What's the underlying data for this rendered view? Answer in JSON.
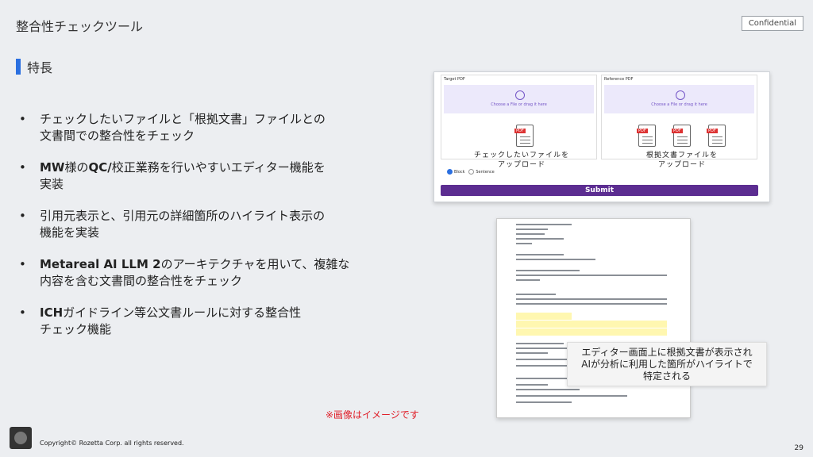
{
  "header": {
    "title": "整合性チェックツール",
    "badge": "Confidential"
  },
  "section": {
    "title": "特長"
  },
  "bullets": [
    [
      "",
      "チェックしたいファイルと「根拠文書」ファイルとの",
      ""
    ],
    [
      "",
      "文書間での整合性をチェック",
      ""
    ]
  ],
  "features": {
    "b1_line1": "チェックしたいファイルと「根拠文書」ファイルとの",
    "b1_line2": "文書間での整合性をチェック",
    "b2_bold1": "MW",
    "b2_text1": "様の",
    "b2_bold2": "QC/",
    "b2_text2": "校正業務を行いやすいエディター機能を",
    "b2_line2": "実装",
    "b3_line1": "引用元表示と、引用元の詳細箇所のハイライト表示の",
    "b3_line2": "機能を実装",
    "b4_bold": "Metareal AI LLM 2",
    "b4_text": "のアーキテクチャを用いて、複雑な",
    "b4_line2": "内容を含む文書間の整合性をチェック",
    "b5_bold": "ICH",
    "b5_text": "ガイドライン等公文書ルールに対する整合性",
    "b5_line2": "チェック機能"
  },
  "upload": {
    "target_title": "Target PDF",
    "reference_title": "Reference PDF",
    "drop_text": "Choose a File or drag it here",
    "target_caption": "チェックしたいファイルを\nアップロード",
    "reference_caption": "根拠文書ファイルを\nアップロード",
    "radio_block": "Block",
    "radio_sentence": "Sentence",
    "submit": "Submit",
    "pdf_tag": "PDF"
  },
  "callout": {
    "line1": "エディター画面上に根拠文書が表示され",
    "line2": "AIが分析に利用した箇所がハイライトで",
    "line3": "特定される"
  },
  "note": "※画像はイメージです",
  "footer": {
    "copyright": "Copyright© Rozetta Corp. all rights reserved.",
    "page": "29"
  },
  "colors": {
    "accent": "#2a6fe0",
    "submit": "#5c2d91",
    "note": "#e0202a"
  }
}
